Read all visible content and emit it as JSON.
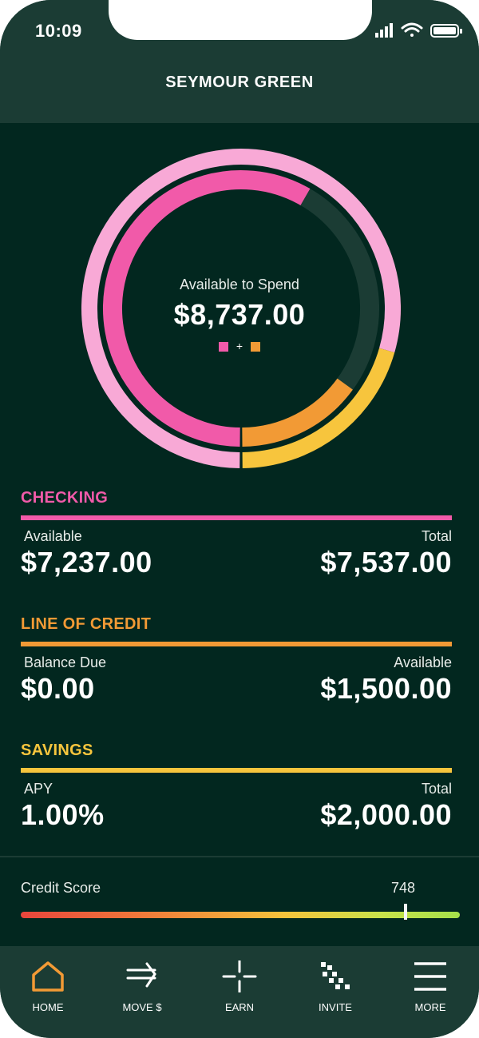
{
  "status": {
    "time": "10:09"
  },
  "header": {
    "name": "SEYMOUR GREEN"
  },
  "summary": {
    "label": "Available to Spend",
    "amount": "$8,737.00",
    "legend_plus": "+"
  },
  "colors": {
    "checking": "#f15aa9",
    "checking_light": "#f8a9d6",
    "credit": "#f29a35",
    "savings": "#f7c53d",
    "bg": "#02271f",
    "panel": "#1b3c34"
  },
  "accounts": {
    "checking": {
      "title": "CHECKING",
      "left_label": "Available",
      "left_value": "$7,237.00",
      "right_label": "Total",
      "right_value": "$7,537.00"
    },
    "credit": {
      "title": "LINE OF CREDIT",
      "left_label": "Balance Due",
      "left_value": "$0.00",
      "right_label": "Available",
      "right_value": "$1,500.00"
    },
    "savings": {
      "title": "SAVINGS",
      "left_label": "APY",
      "left_value": "1.00%",
      "right_label": "Total",
      "right_value": "$2,000.00"
    }
  },
  "credit_score": {
    "label": "Credit Score",
    "value": "748"
  },
  "tabs": [
    {
      "label": "HOME",
      "icon": "home-icon",
      "active": true
    },
    {
      "label": "MOVE $",
      "icon": "transfer-icon",
      "active": false
    },
    {
      "label": "EARN",
      "icon": "earn-icon",
      "active": false
    },
    {
      "label": "INVITE",
      "icon": "invite-icon",
      "active": false
    },
    {
      "label": "MORE",
      "icon": "menu-icon",
      "active": false
    }
  ]
}
